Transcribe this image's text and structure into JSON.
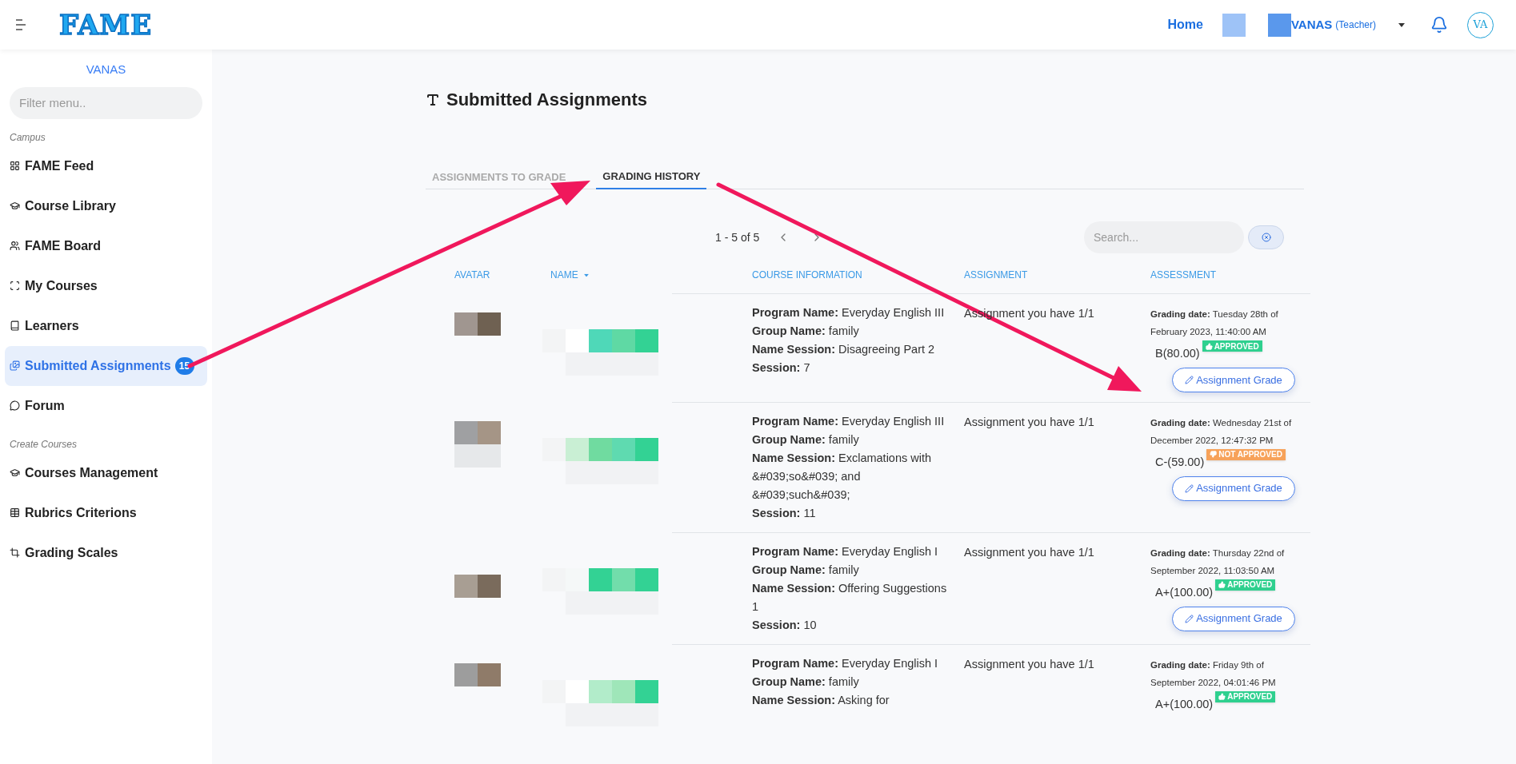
{
  "header": {
    "logo": "FAME",
    "home_link": "Home",
    "user_name": "VANAS",
    "user_role": "(Teacher)",
    "avatar_initials": "VA"
  },
  "sidebar": {
    "org": "VANAS",
    "filter_placeholder": "Filter menu..",
    "sections": [
      {
        "title": "Campus",
        "items": [
          {
            "label": "FAME Feed",
            "kind": "grid",
            "selected": false
          },
          {
            "label": "Course Library",
            "kind": "cap",
            "selected": false
          },
          {
            "label": "FAME Board",
            "kind": "users",
            "selected": false
          },
          {
            "label": "My Courses",
            "kind": "scan",
            "selected": false
          },
          {
            "label": "Learners",
            "kind": "book",
            "selected": false
          },
          {
            "label": "Submitted Assignments",
            "kind": "images",
            "selected": true,
            "badge": "15"
          },
          {
            "label": "Forum",
            "kind": "chat",
            "selected": false
          }
        ]
      },
      {
        "title": "Create Courses",
        "items": [
          {
            "label": "Courses Management",
            "kind": "cap",
            "selected": false
          },
          {
            "label": "Rubrics Criterions",
            "kind": "table",
            "selected": false
          },
          {
            "label": "Grading Scales",
            "kind": "crop",
            "selected": false
          }
        ]
      }
    ]
  },
  "page_title": "Submitted Assignments",
  "tabs": [
    {
      "label": "ASSIGNMENTS TO GRADE",
      "selected": false
    },
    {
      "label": "GRADING HISTORY",
      "selected": true
    }
  ],
  "pagination": "1 - 5 of 5",
  "search": {
    "placeholder": "Search..."
  },
  "table": {
    "columns": [
      {
        "label": "AVATAR"
      },
      {
        "label": "NAME",
        "sortable": true
      },
      {
        "label": "COURSE INFORMATION"
      },
      {
        "label": "ASSIGNMENT"
      },
      {
        "label": "ASSESSMENT"
      }
    ],
    "rows": [
      {
        "course": [
          "**Program Name:** Everyday English III",
          "**Group Name:** family",
          "**Name Session:** Disagreeing Part 2",
          "**Session:** 7"
        ],
        "assignment": "Assignment you have 1/1",
        "grading_date": "**Grading date:** Tuesday 28th of February 2023, 11:40:00 AM",
        "grade": "B(80.00)",
        "status": {
          "label": "APPROVED",
          "kind": "approved"
        },
        "button": "Assignment Grade"
      },
      {
        "course": [
          "**Program Name:** Everyday English III",
          "**Group Name:** family",
          "**Name Session:** Exclamations with &#039;so&#039; and &#039;such&#039;",
          "**Session:** 11"
        ],
        "assignment": "Assignment you have 1/1",
        "grading_date": "**Grading date:** Wednesday 21st of December 2022, 12:47:32 PM",
        "grade": "C-(59.00)",
        "status": {
          "label": "NOT APPROVED",
          "kind": "not_approved"
        },
        "button": "Assignment Grade"
      },
      {
        "course": [
          "**Program Name:** Everyday English I",
          "**Group Name:** family",
          "**Name Session:** Offering Suggestions 1",
          "**Session:** 10"
        ],
        "assignment": "Assignment you have 1/1",
        "grading_date": "**Grading date:** Thursday 22nd of September 2022, 11:03:50 AM",
        "grade": "A+(100.00)",
        "status": {
          "label": "APPROVED",
          "kind": "approved"
        },
        "button": "Assignment Grade"
      },
      {
        "course": [
          "**Program Name:** Everyday English I",
          "**Group Name:** family",
          "**Name Session:** Asking for"
        ],
        "assignment": "Assignment you have 1/1",
        "grading_date": "**Grading date:** Friday 9th of September 2022, 04:01:46 PM",
        "grade": "A+(100.00)",
        "status": {
          "label": "APPROVED",
          "kind": "approved"
        }
      }
    ]
  }
}
